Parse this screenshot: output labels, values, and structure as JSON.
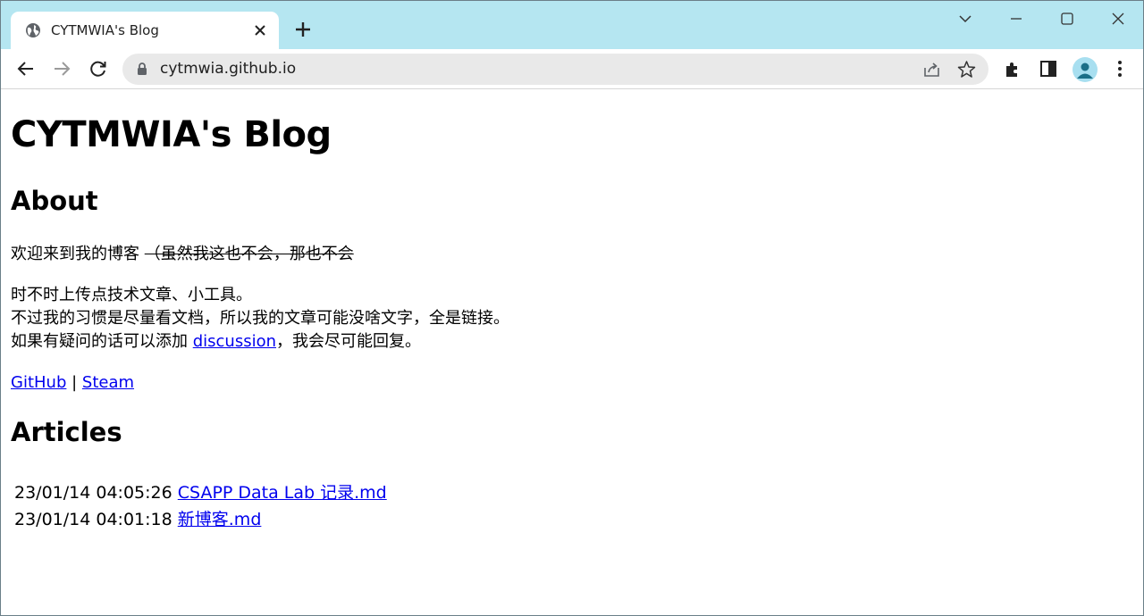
{
  "browser": {
    "tab": {
      "title": "CYTMWIA's Blog",
      "favicon": "globe-icon"
    },
    "url": "cytmwia.github.io",
    "accent": "#b5e6f1"
  },
  "page": {
    "title": "CYTMWIA's Blog",
    "about": {
      "heading": "About",
      "welcome": "欢迎来到我的博客",
      "welcome_struck": "（虽然我这也不会，那也不会",
      "line1": "时不时上传点技术文章、小工具。",
      "line2": "不过我的习惯是尽量看文档，所以我的文章可能没啥文字，全是链接。",
      "line3_pre": "如果有疑问的话可以添加 ",
      "line3_link": "discussion",
      "line3_post": "，我会尽可能回复。",
      "github": "GitHub",
      "separator": " | ",
      "steam": "Steam"
    },
    "articles": {
      "heading": "Articles",
      "items": [
        {
          "time": "23/01/14 04:05:26",
          "title": "CSAPP Data Lab 记录.md"
        },
        {
          "time": "23/01/14 04:01:18",
          "title": "新博客.md"
        }
      ]
    }
  }
}
